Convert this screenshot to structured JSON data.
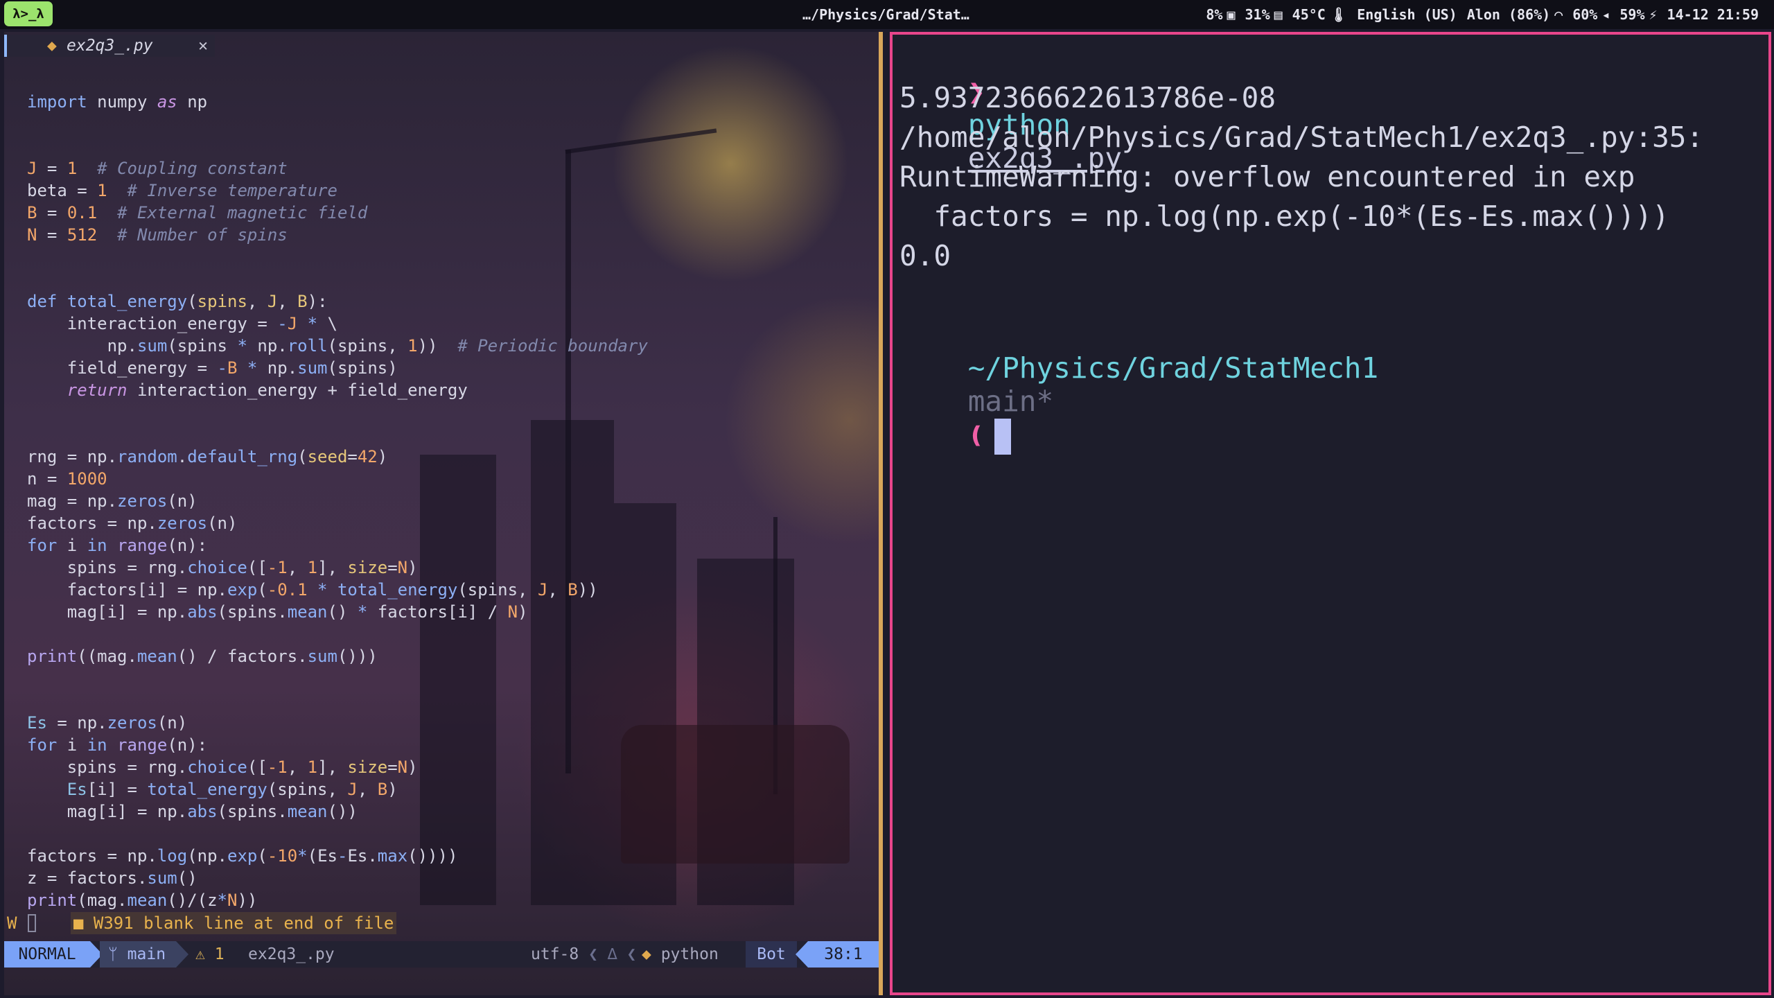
{
  "topbar": {
    "logo": "λ>_λ",
    "window_title": "…/Physics/Grad/Stat…",
    "cpu": "8%",
    "memory": "31%",
    "temperature": "45°C",
    "keyboard_layout": "English (US)",
    "wifi_network": "Alon (86%)",
    "brightness": "60%",
    "volume": "59%",
    "datetime": "14-12 21:59"
  },
  "editor": {
    "tab": {
      "filename": "ex2q3_.py",
      "close": "✕"
    },
    "diagnostic": {
      "sign": "W",
      "message": "■ W391 blank line at end of file"
    },
    "statusline": {
      "mode": "NORMAL",
      "branch": "main",
      "warnings": "⚠ 1",
      "filename": "ex2q3_.py",
      "encoding": "utf-8",
      "filetype": "python",
      "scroll": "Bot",
      "position": "38:1"
    }
  },
  "terminal": {
    "prompt_symbol": "❯",
    "command": "python",
    "command_arg": "ex2q3_.py",
    "output": [
      "5.9372366622613786e-08",
      "/home/alon/Physics/Grad/StatMech1/ex2q3_.py:35:",
      "RuntimeWarning: overflow encountered in exp",
      "  factors = np.log(np.exp(-10*(Es-Es.max())))",
      "0.0"
    ],
    "cwd": "~/Physics/Grad/StatMech1",
    "git_branch": "main*",
    "prompt_end": "❪"
  },
  "colors": {
    "terminal_border": "#e8458b",
    "editor_border": "#d9a65a",
    "mode_bg": "#7aa2f7",
    "logo_bg": "#9ce36d"
  }
}
